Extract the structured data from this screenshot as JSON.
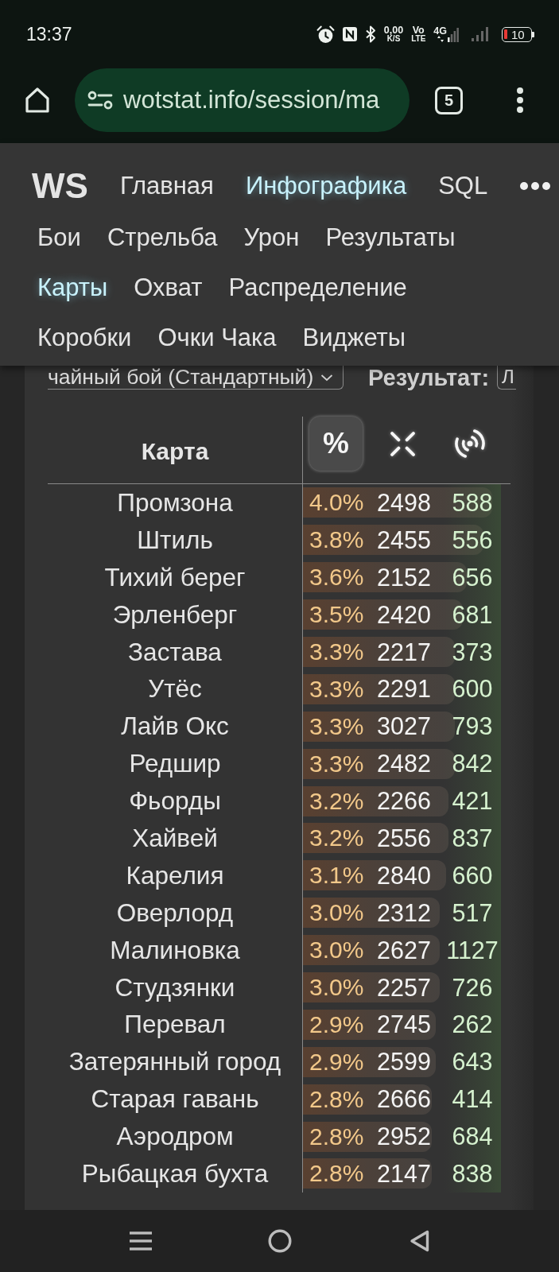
{
  "status_bar": {
    "time": "13:37",
    "net_speed": "0,00",
    "net_speed_unit": "K/S",
    "volte_top": "Vo",
    "volte_bottom": "LTE",
    "network": "4G",
    "battery": "10"
  },
  "browser": {
    "url": "wotstat.info/session/ma",
    "tab_count": "5"
  },
  "nav": {
    "logo": "WS",
    "items": [
      {
        "label": "Главная",
        "selected": false
      },
      {
        "label": "Инфографика",
        "selected": true
      },
      {
        "label": "SQL",
        "selected": false
      }
    ],
    "sub_items": [
      {
        "label": "Бои",
        "selected": false
      },
      {
        "label": "Стрельба",
        "selected": false
      },
      {
        "label": "Урон",
        "selected": false
      },
      {
        "label": "Результаты",
        "selected": false
      },
      {
        "label": "Карты",
        "selected": true
      },
      {
        "label": "Охват",
        "selected": false
      },
      {
        "label": "Распределение",
        "selected": false
      },
      {
        "label": "Коробки",
        "selected": false
      },
      {
        "label": "Очки Чака",
        "selected": false
      },
      {
        "label": "Виджеты",
        "selected": false
      }
    ]
  },
  "filters": {
    "battle_type": "чайный бой (Стандартный)",
    "result_label": "Результат:",
    "result": "Л"
  },
  "table": {
    "map_column": "Карта",
    "stat_columns": [
      {
        "kind": "text",
        "label": "%",
        "selected": true
      },
      {
        "kind": "icon",
        "selected": false
      },
      {
        "kind": "icon",
        "selected": false
      }
    ],
    "rows": [
      {
        "map": "Промзона",
        "percent": "4.0%",
        "level": 0.91,
        "column_2": "2498",
        "column_3": "588"
      },
      {
        "map": "Штиль",
        "percent": "3.8%",
        "level": 0.87,
        "column_2": "2455",
        "column_3": "556"
      },
      {
        "map": "Тихий берег",
        "percent": "3.6%",
        "level": 0.79,
        "column_2": "2152",
        "column_3": "656"
      },
      {
        "map": "Эрленберг",
        "percent": "3.5%",
        "level": 0.77,
        "column_2": "2420",
        "column_3": "681"
      },
      {
        "map": "Застава",
        "percent": "3.3%",
        "level": 0.73,
        "column_2": "2217",
        "column_3": "373"
      },
      {
        "map": "Утёс",
        "percent": "3.3%",
        "level": 0.73,
        "column_2": "2291",
        "column_3": "600"
      },
      {
        "map": "Лайв Окс",
        "percent": "3.3%",
        "level": 0.73,
        "column_2": "3027",
        "column_3": "793"
      },
      {
        "map": "Редшир",
        "percent": "3.3%",
        "level": 0.73,
        "column_2": "2482",
        "column_3": "842"
      },
      {
        "map": "Фьорды",
        "percent": "3.2%",
        "level": 0.7,
        "column_2": "2266",
        "column_3": "421"
      },
      {
        "map": "Хайвей",
        "percent": "3.2%",
        "level": 0.7,
        "column_2": "2556",
        "column_3": "837"
      },
      {
        "map": "Карелия",
        "percent": "3.1%",
        "level": 0.69,
        "column_2": "2840",
        "column_3": "660"
      },
      {
        "map": "Оверлорд",
        "percent": "3.0%",
        "level": 0.66,
        "column_2": "2312",
        "column_3": "517"
      },
      {
        "map": "Малиновка",
        "percent": "3.0%",
        "level": 0.66,
        "column_2": "2627",
        "column_3": "1127"
      },
      {
        "map": "Студзянки",
        "percent": "3.0%",
        "level": 0.66,
        "column_2": "2257",
        "column_3": "726"
      },
      {
        "map": "Перевал",
        "percent": "2.9%",
        "level": 0.64,
        "column_2": "2745",
        "column_3": "262"
      },
      {
        "map": "Затерянный город",
        "percent": "2.9%",
        "level": 0.64,
        "column_2": "2599",
        "column_3": "643"
      },
      {
        "map": "Старая гавань",
        "percent": "2.8%",
        "level": 0.62,
        "column_2": "2666",
        "column_3": "414"
      },
      {
        "map": "Аэродром",
        "percent": "2.8%",
        "level": 0.62,
        "column_2": "2952",
        "column_3": "684"
      },
      {
        "map": "Рыбацкая бухта",
        "percent": "2.8%",
        "level": 0.62,
        "column_2": "2147",
        "column_3": "838"
      }
    ]
  }
}
